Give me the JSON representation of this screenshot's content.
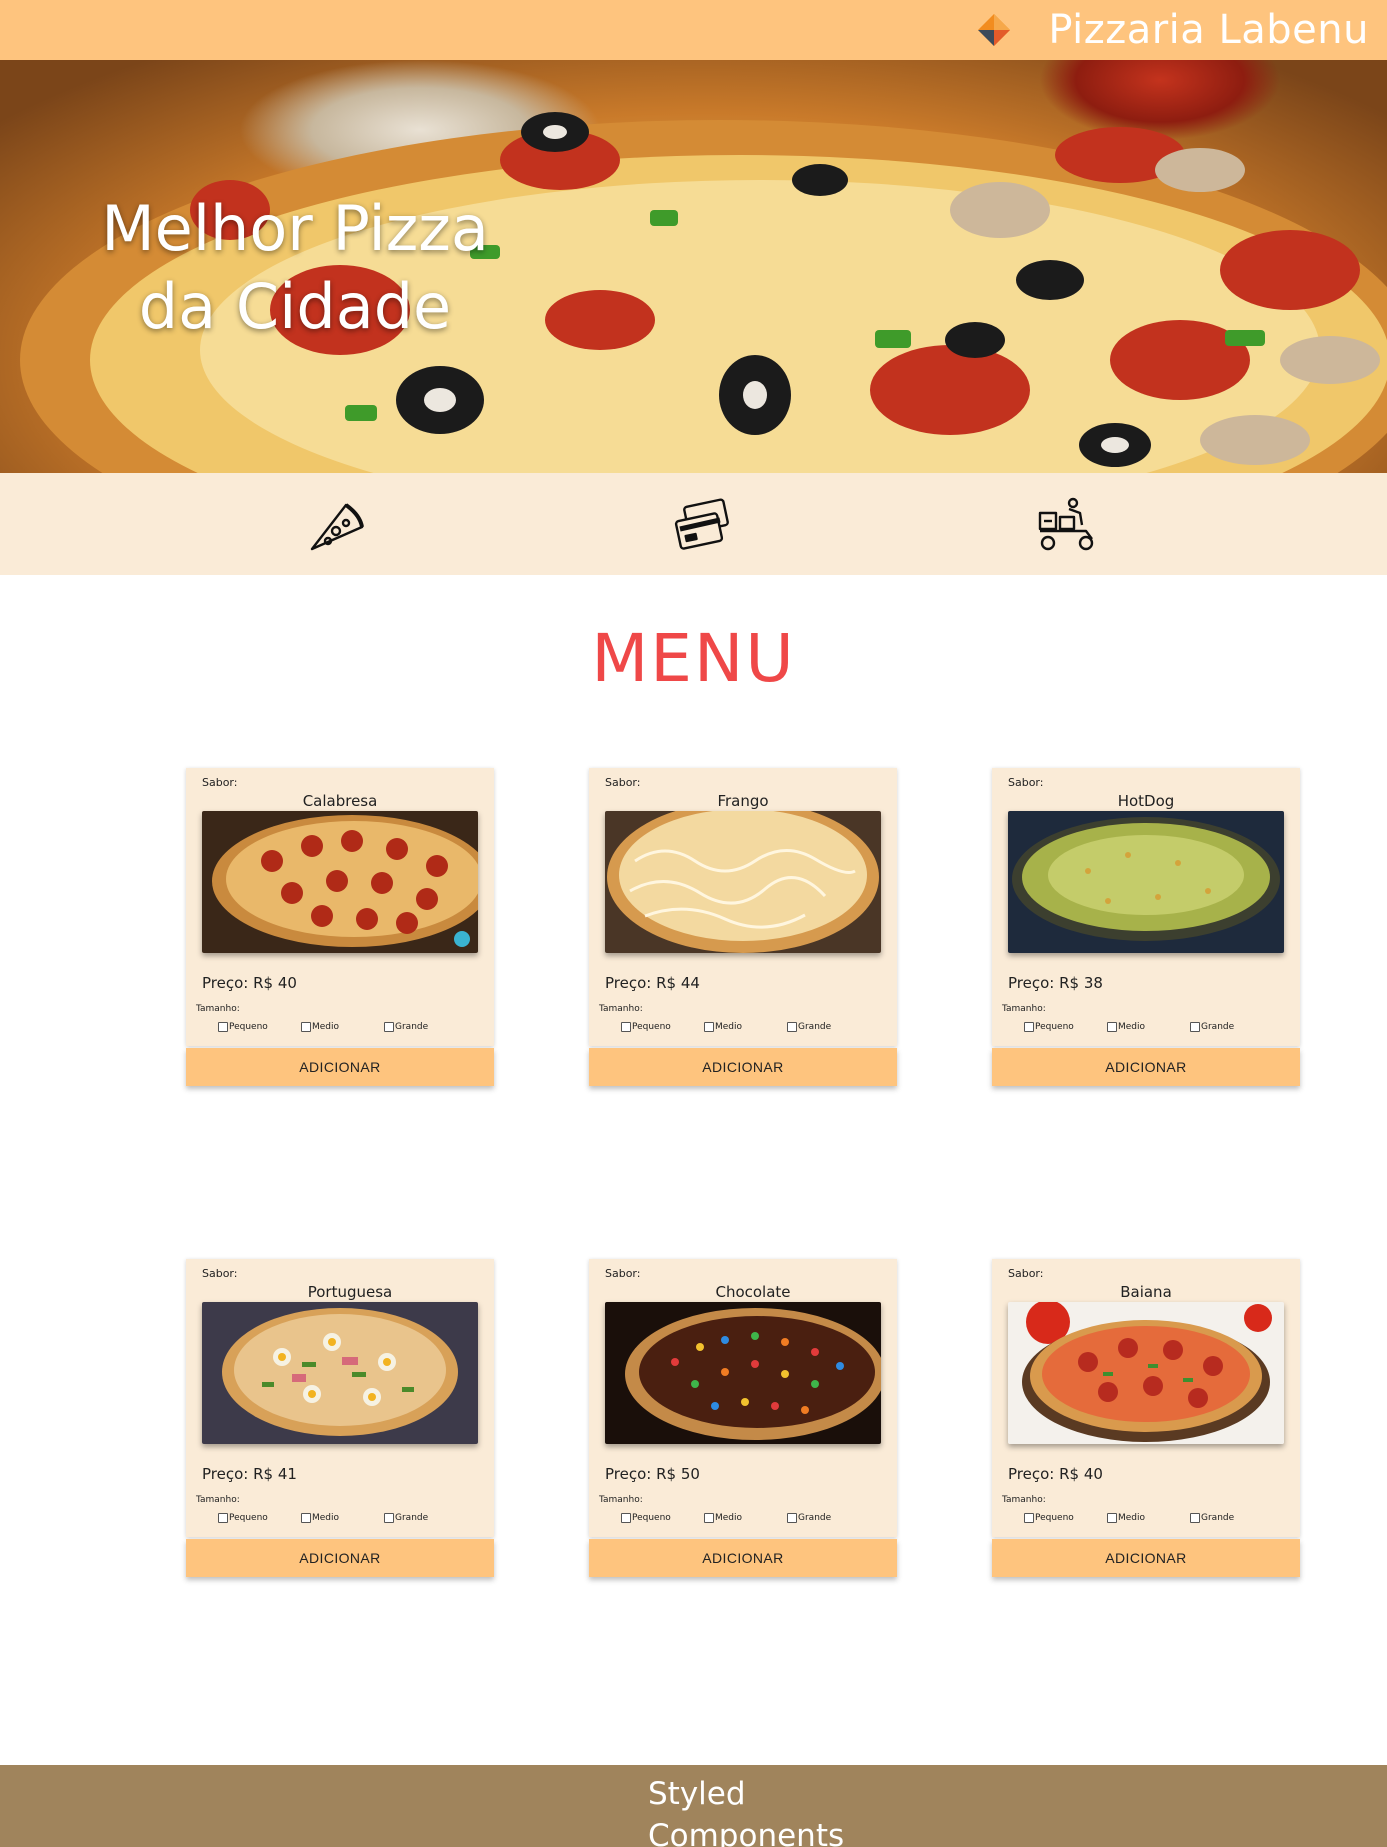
{
  "header": {
    "title": "Pizzaria Labenu",
    "logo_icon": "diamond-logo-icon"
  },
  "hero": {
    "title": "Melhor Pizza da Cidade"
  },
  "features": [
    {
      "icon": "pizza-slice-icon"
    },
    {
      "icon": "credit-cards-icon"
    },
    {
      "icon": "delivery-scooter-icon"
    }
  ],
  "menu": {
    "title": "MENU",
    "sabor_label": "Sabor:",
    "tamanho_label": "Tamanho:",
    "sizes": [
      "Pequeno",
      "Medio",
      "Grande"
    ],
    "add_label": "ADICIONAR",
    "items": [
      {
        "flavor": "Calabresa",
        "price": "Preço: R$ 40"
      },
      {
        "flavor": "Frango",
        "price": "Preço: R$ 44"
      },
      {
        "flavor": "HotDog",
        "price": "Preço: R$ 38"
      },
      {
        "flavor": "Portuguesa",
        "price": "Preço: R$ 41"
      },
      {
        "flavor": "Chocolate",
        "price": "Preço: R$ 50"
      },
      {
        "flavor": "Baiana",
        "price": "Preço: R$ 40"
      }
    ]
  },
  "footer": {
    "text": "Styled Components"
  },
  "colors": {
    "header": "#fec47e",
    "feature_strip": "#faebd7",
    "menu_title": "#ef4848",
    "card": "#faebd7",
    "button": "#fec47e",
    "footer": "#a0845c"
  }
}
